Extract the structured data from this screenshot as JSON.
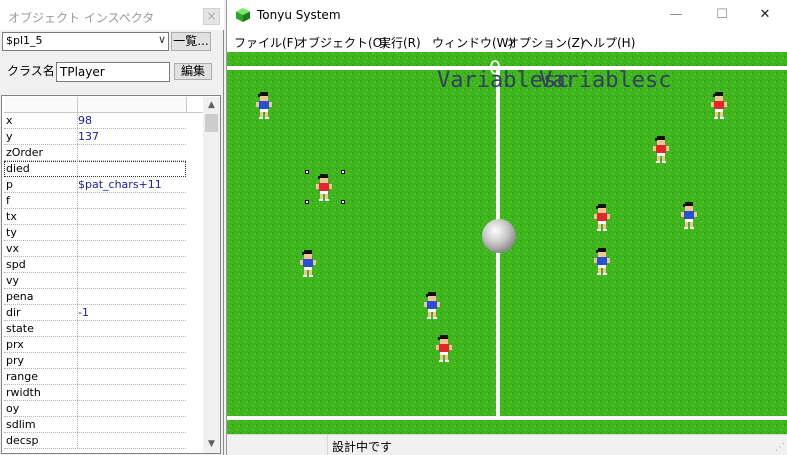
{
  "inspector": {
    "title": "オブジェクト インスペクタ",
    "close": "×",
    "object_select_value": "$pl1_5",
    "list_button": "一覧...",
    "class_label": "クラス名",
    "class_value": "TPlayer",
    "edit_button": "編集",
    "properties": [
      {
        "key": "x",
        "value": "98"
      },
      {
        "key": "y",
        "value": "137"
      },
      {
        "key": "zOrder",
        "value": ""
      },
      {
        "key": "died",
        "value": ""
      },
      {
        "key": "p",
        "value": "$pat_chars+11"
      },
      {
        "key": "f",
        "value": ""
      },
      {
        "key": "tx",
        "value": ""
      },
      {
        "key": "ty",
        "value": ""
      },
      {
        "key": "vx",
        "value": ""
      },
      {
        "key": "spd",
        "value": ""
      },
      {
        "key": "vy",
        "value": ""
      },
      {
        "key": "pena",
        "value": ""
      },
      {
        "key": "dir",
        "value": "-1"
      },
      {
        "key": "state",
        "value": ""
      },
      {
        "key": "prx",
        "value": ""
      },
      {
        "key": "pry",
        "value": ""
      },
      {
        "key": "range",
        "value": ""
      },
      {
        "key": "rwidth",
        "value": ""
      },
      {
        "key": "oy",
        "value": ""
      },
      {
        "key": "sdlim",
        "value": ""
      },
      {
        "key": "decsp",
        "value": ""
      }
    ]
  },
  "tonyu": {
    "title": "Tonyu System",
    "window_controls": {
      "minimize": "—",
      "maximize": "☐",
      "close": "✕"
    },
    "menu": [
      {
        "label": "ファイル(F)"
      },
      {
        "label": "オブジェクト(O)"
      },
      {
        "label": "実行(R)"
      },
      {
        "label": "ウィンドウ(W)"
      },
      {
        "label": "オプション(Z)"
      },
      {
        "label": "ヘルプ(H)"
      }
    ],
    "score": "0",
    "variable_text_1": "Variablesc",
    "variable_text_2": "Variablesc",
    "status": "設計中です",
    "status_grip": "⋰",
    "colors": {
      "field_green": "#3fb51e",
      "red_team": "#e02828",
      "blue_team": "#2850d0"
    }
  }
}
